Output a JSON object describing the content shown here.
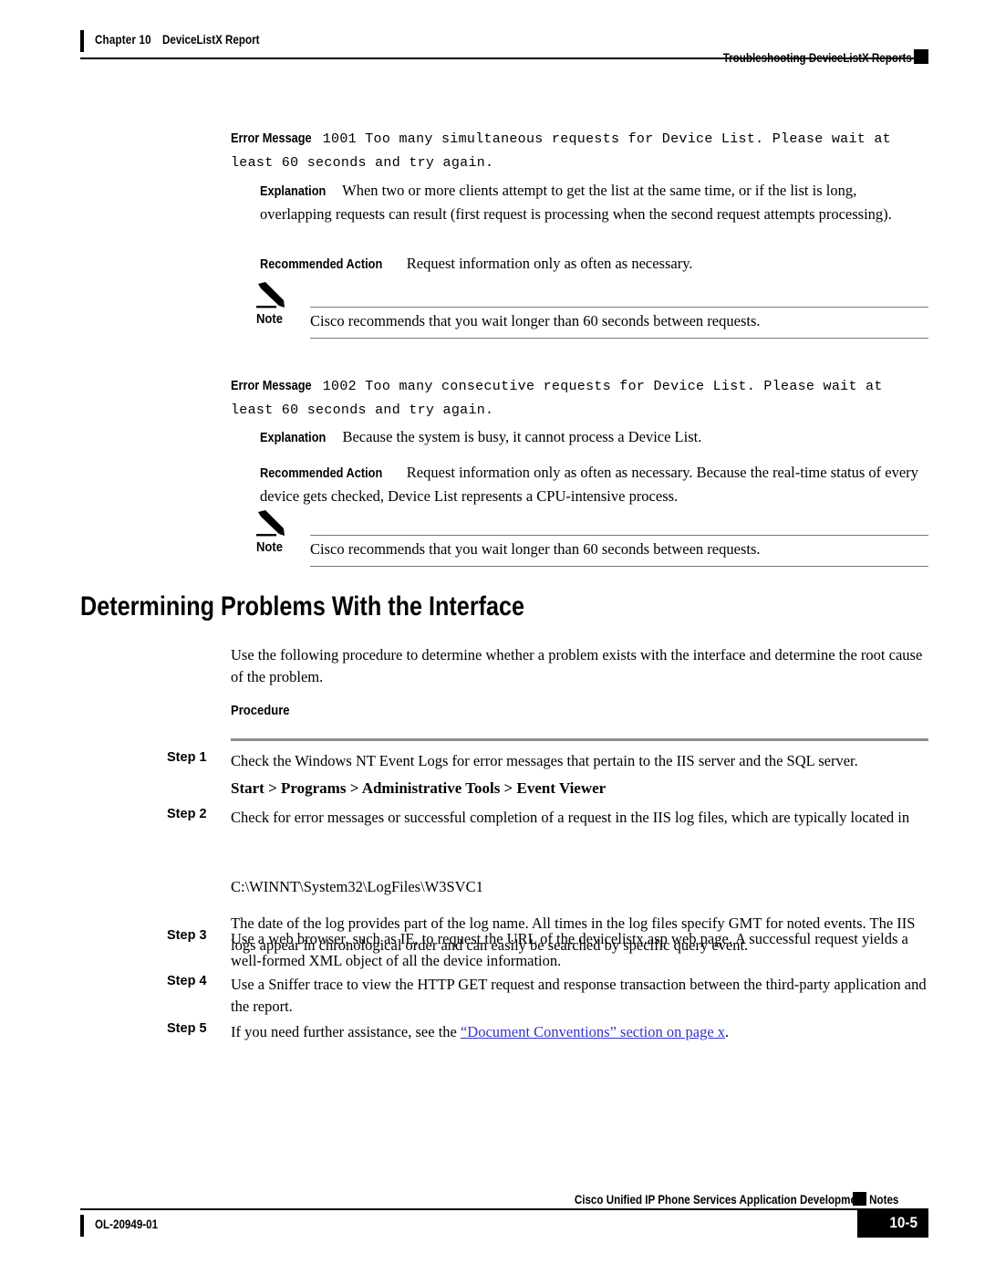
{
  "header": {
    "chapter": "Chapter 10",
    "chapter_title": "DeviceListX Report",
    "running_head": "Troubleshooting DeviceListX Reports"
  },
  "errors": [
    {
      "label": "Error Message",
      "message": "1001 Too many simultaneous requests for Device List. Please wait at least 60 seconds and try again.",
      "explanation_label": "Explanation",
      "explanation": "When two or more clients attempt to get the list at the same time, or if the list is long, overlapping requests can result (first request is processing when the second request attempts processing).",
      "action_label": "Recommended Action",
      "action": "Request information only as often as necessary.",
      "note_label": "Note",
      "note": "Cisco recommends that you wait longer than 60 seconds between requests."
    },
    {
      "label": "Error Message",
      "message": "1002 Too many consecutive requests for Device List. Please wait at least 60 seconds and try again.",
      "explanation_label": "Explanation",
      "explanation": "Because the system is busy, it cannot process a Device List.",
      "action_label": "Recommended Action",
      "action": "Request information only as often as necessary. Because the real-time status of every device gets checked, Device List represents a CPU-intensive process.",
      "note_label": "Note",
      "note": "Cisco recommends that you wait longer than 60 seconds between requests."
    }
  ],
  "section": {
    "heading": "Determining Problems With the Interface",
    "intro": "Use the following procedure to determine whether a problem exists with the interface and determine the root cause of the problem.",
    "procedure_label": "Procedure"
  },
  "steps": [
    {
      "num": "Step 1",
      "text": "Check the Windows NT Event Logs for error messages that pertain to the IIS server and the SQL server.",
      "sub_bold": "Start > Programs > Administrative Tools > Event Viewer"
    },
    {
      "num": "Step 2",
      "text": "Check for error messages or successful completion of a request in the IIS log files, which are typically located in",
      "sub_path": "C:\\WINNT\\System32\\LogFiles\\W3SVC1",
      "sub_note": "The date of the log provides part of the log name. All times in the log files specify GMT for noted events. The IIS logs appear in chronological order and can easily be searched by specific query event."
    },
    {
      "num": "Step 3",
      "text": "Use a web browser, such as IE, to request the URL of the devicelistx.asp web page. A successful request yields a well-formed XML object of all the device information."
    },
    {
      "num": "Step 4",
      "text": "Use a Sniffer trace to view the HTTP GET request and response transaction between the third-party application and the report."
    },
    {
      "num": "Step 5",
      "text_before": "If you need further assistance, see the ",
      "link": "“Document Conventions” section on page x",
      "text_after": "."
    }
  ],
  "footer": {
    "running_head": "Cisco Unified IP Phone Services Application Development Notes",
    "doc_number": "OL-20949-01",
    "page_number": "10-5"
  },
  "colors": {
    "link": "#3333cc",
    "rule": "#000000",
    "rule_gray": "#8c8c8c"
  }
}
